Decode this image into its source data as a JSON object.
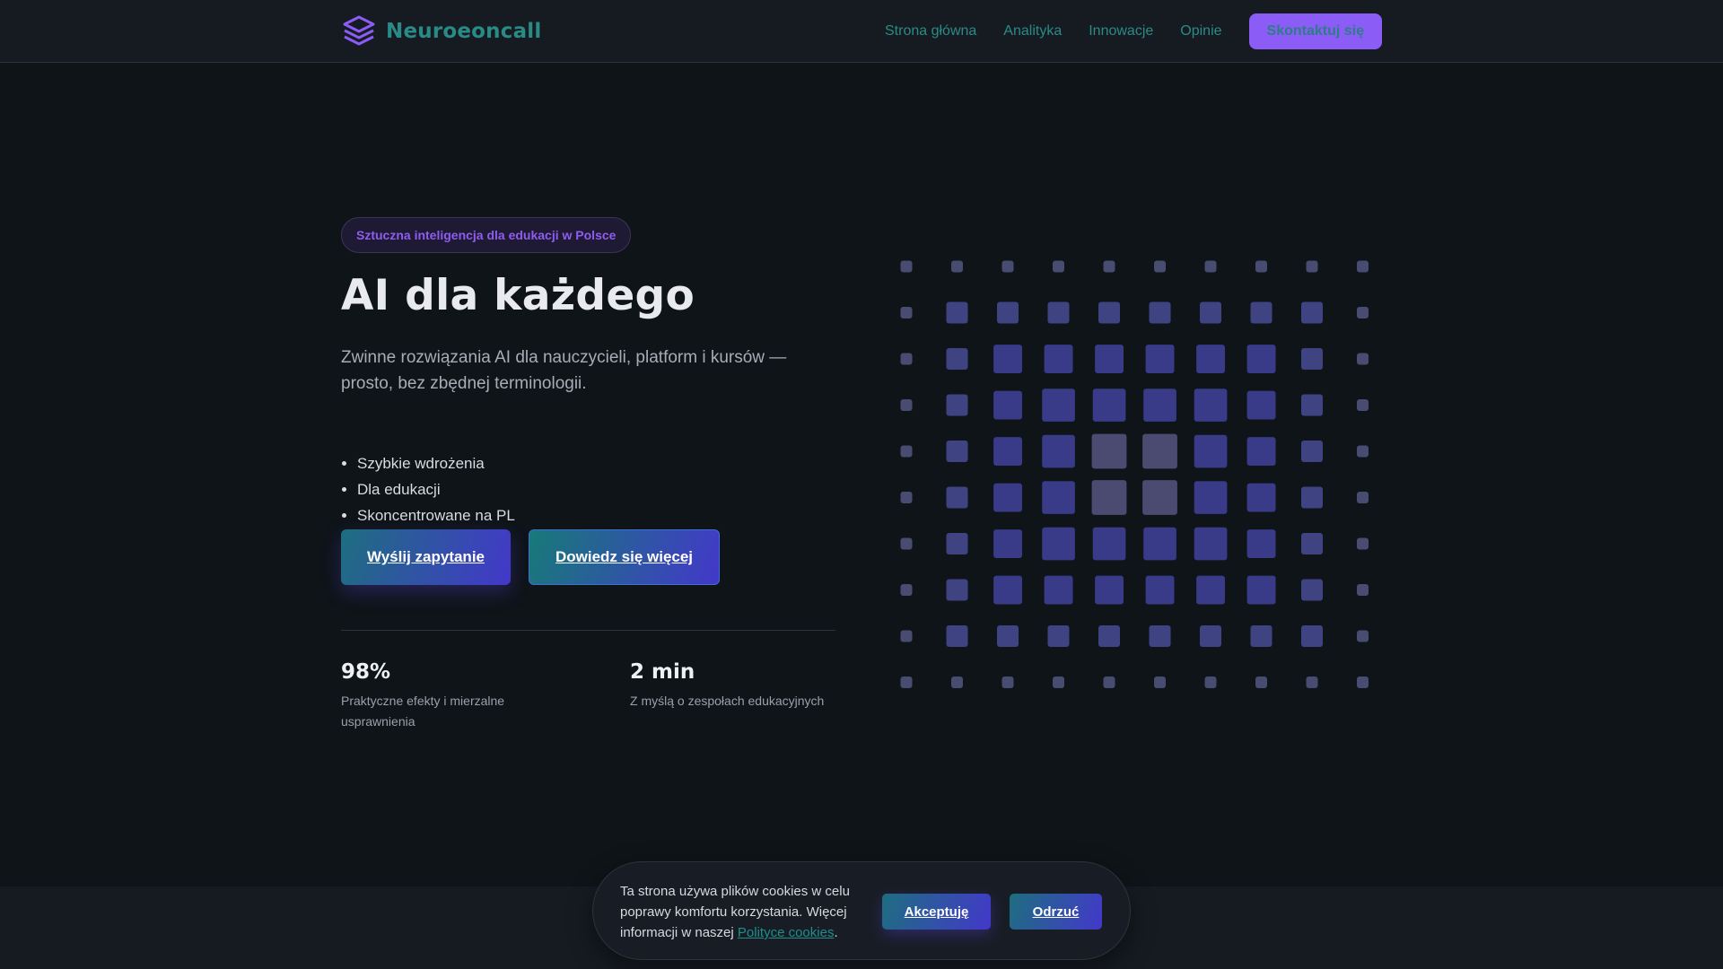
{
  "header": {
    "brand": "Neuroeoncall",
    "logo_icon": "layers-icon",
    "nav": [
      {
        "label": "Strona główna"
      },
      {
        "label": "Analityka"
      },
      {
        "label": "Innowacje"
      },
      {
        "label": "Opinie"
      }
    ],
    "cta_label": "Skontaktuj się"
  },
  "hero": {
    "badge": "Sztuczna inteligencja dla edukacji w Polsce",
    "title": "AI dla każdego",
    "subtitle": "Zwinne rozwiązania AI dla nauczycieli, platform i kursów — prosto, bez zbędnej terminologii.",
    "features": [
      "Szybkie wdrożenia",
      "Dla edukacji",
      "Skoncentrowane na PL"
    ],
    "primary_button": "Wyślij zapytanie",
    "secondary_button": "Dowiedz się więcej"
  },
  "stats": [
    {
      "value": "98%",
      "label": "Praktyczne efekty i mierzalne usprawnienia"
    },
    {
      "value": "2 min",
      "label": "Z myślą o zespołach edukacyjnych"
    }
  ],
  "cookie": {
    "text_before": "Ta strona używa plików cookies w celu poprawy komfortu korzystania. Więcej informacji w naszej ",
    "link_label": "Polityce cookies",
    "text_after": ".",
    "accept_label": "Akceptuję",
    "reject_label": "Odrzuć"
  },
  "colors": {
    "accent_purple": "#8b5cf6",
    "accent_teal": "#2a8a86",
    "grid_square": "#3b3b8c",
    "grid_square_light": "#4a4870"
  }
}
